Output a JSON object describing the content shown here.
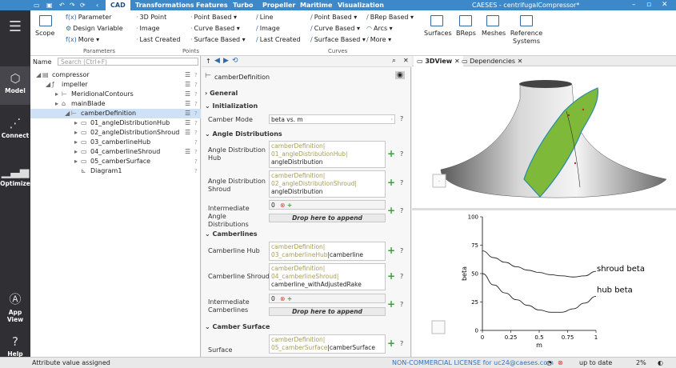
{
  "titlebar": {
    "title": "CAESES - centrifugalCompressor*",
    "tabs": [
      "CAD",
      "Transformations",
      "Features",
      "Turbo",
      "Propeller",
      "Maritime",
      "Visualization"
    ],
    "active_tab": "CAD"
  },
  "ribbon": {
    "scope": "Scope",
    "parameters": {
      "parameter": "Parameter",
      "design_variable": "Design Variable",
      "more": "More",
      "group": "Parameters"
    },
    "points": {
      "point3d": "3D Point",
      "image": "Image",
      "last_created": "Last Created",
      "point_based": "Point Based",
      "curve_based": "Curve Based",
      "surface_based": "Surface Based",
      "group": "Points"
    },
    "curves": {
      "line": "Line",
      "image": "Image",
      "last_created": "Last Created",
      "point_based": "Point Based",
      "curve_based": "Curve Based",
      "surface_based": "Surface Based",
      "brep_based": "BRep Based",
      "arcs": "Arcs",
      "more": "More",
      "group": "Curves"
    },
    "big": [
      "Surfaces",
      "BReps",
      "Meshes",
      "Reference Systems"
    ]
  },
  "nav": [
    "Model",
    "Connect",
    "Optimize",
    "App View",
    "Help"
  ],
  "tree": {
    "header": "Name",
    "search_placeholder": "Search (Ctrl+F)",
    "items": [
      {
        "label": "compressor",
        "depth": 0
      },
      {
        "label": "impeller",
        "depth": 1
      },
      {
        "label": "MeridionalContours",
        "depth": 2
      },
      {
        "label": "mainBlade",
        "depth": 2
      },
      {
        "label": "camberDefinition",
        "depth": 3
      },
      {
        "label": "01_angleDistributionHub",
        "depth": 4
      },
      {
        "label": "02_angleDistributionShroud",
        "depth": 4
      },
      {
        "label": "03_camberlineHub",
        "depth": 4
      },
      {
        "label": "04_camberlineShroud",
        "depth": 4
      },
      {
        "label": "05_camberSurface",
        "depth": 4
      },
      {
        "label": "Diagram1",
        "depth": 4
      }
    ]
  },
  "editor": {
    "object": "camberDefinition",
    "sections": {
      "general": "General",
      "init": "Initialization",
      "angle": "Angle Distributions",
      "camberlines": "Camberlines",
      "surface": "Camber Surface"
    },
    "camber_mode_label": "Camber Mode",
    "camber_mode_value": "beta vs. m",
    "adh_label": "Angle Distribution Hub",
    "adh_l1": "camberDefinition|",
    "adh_l2": "01_angleDistributionHub|",
    "adh_l3": "angleDistribution",
    "ads_label": "Angle Distribution Shroud",
    "ads_l1": "camberDefinition|",
    "ads_l2": "02_angleDistributionShroud|",
    "ads_l3": "angleDistribution",
    "iad_label": "Intermediate Angle Distributions",
    "drop": "Drop here to append",
    "clh_label": "Camberline Hub",
    "clh_l1": "camberDefinition|",
    "clh_l2": "03_camberlineHub",
    "clh_l2b": "|camberline",
    "cls_label": "Camberline Shroud",
    "cls_l1": "camberDefinition|",
    "cls_l2": "04_camberlineShroud|",
    "cls_l3": "camberline_withAdjustedRake",
    "icl_label": "Intermediate Camberlines",
    "surf_label": "Surface",
    "surf_l1": "camberDefinition|",
    "surf_l2": "05_camberSurface",
    "surf_l2b": "|camberSurface",
    "counter": "0"
  },
  "views": {
    "tab1": "3DView",
    "tab2": "Dependencies"
  },
  "chart_data": {
    "type": "line",
    "xlabel": "m",
    "ylabel": "beta",
    "xlim": [
      0,
      1
    ],
    "ylim": [
      0,
      100
    ],
    "x_ticks": [
      "0",
      "0.25",
      "0.5",
      "0.75",
      "1"
    ],
    "y_ticks": [
      "0",
      "25",
      "50",
      "75",
      "100"
    ],
    "series": [
      {
        "name": "shroud beta",
        "x": [
          0,
          0.1,
          0.2,
          0.3,
          0.4,
          0.5,
          0.6,
          0.7,
          0.8,
          0.9,
          1.0
        ],
        "y": [
          70,
          64,
          60,
          56,
          53,
          51,
          49,
          48,
          47,
          48,
          52
        ]
      },
      {
        "name": "hub beta",
        "x": [
          0,
          0.1,
          0.2,
          0.3,
          0.4,
          0.5,
          0.6,
          0.7,
          0.8,
          0.9,
          1.0
        ],
        "y": [
          50,
          40,
          33,
          27,
          22,
          18,
          16,
          16,
          19,
          24,
          30
        ]
      }
    ]
  },
  "status": {
    "message": "Attribute value assigned",
    "license": "NON-COMMERCIAL LICENSE for uc24@caeses.com",
    "state": "up to date",
    "zoom": "2%"
  },
  "colors": {
    "accent": "#3d88c9",
    "sidebar": "#2f2f34"
  }
}
